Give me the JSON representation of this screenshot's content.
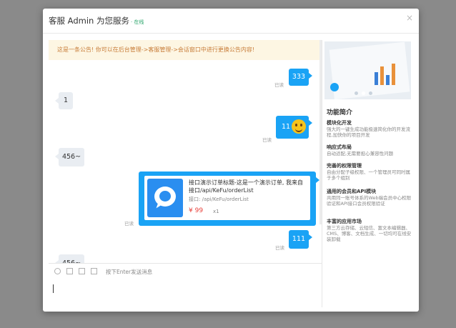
{
  "dialog": {
    "title": "客服 Admin 为您服务",
    "status": "· 在线",
    "close": "×"
  },
  "notice": "这是一条公告! 你可以在后台管理->客服管理->会话窗口中进行更换公告内容!",
  "messages": [
    {
      "from": "me",
      "text": "333",
      "read": "已读"
    },
    {
      "from": "agent",
      "text": "1"
    },
    {
      "from": "me",
      "text": "11",
      "emoji": "smile-emoji-icon",
      "read": "已读"
    },
    {
      "from": "agent",
      "text": "456~"
    },
    {
      "from": "me",
      "type": "order",
      "read": "已读",
      "order": {
        "title": "接口演示订单标题-这是一个演示订单, 我来自接口/api/KeFu/orderList",
        "url": "接口: /api/KeFu/orderList",
        "price": "¥ 99",
        "qty": "x1"
      }
    },
    {
      "from": "me",
      "text": "111",
      "read": "已读"
    },
    {
      "from": "agent",
      "text": "456~"
    }
  ],
  "toolbar": {
    "icons": [
      "smile-icon",
      "folder-icon",
      "image-icon",
      "user-icon"
    ],
    "hint": "按下Enter发送消息"
  },
  "sidebar": {
    "title": "功能简介",
    "features": [
      {
        "name": "模块化开发",
        "desc": "强大的一键生成功能极速简化你的开发流程,加快你的项目开发"
      },
      {
        "name": "响应式布局",
        "desc": "自动适配,无需要担心兼容性问题"
      },
      {
        "name": "完善的权限管理",
        "desc": "自由分配子级权限、一个管理员可同时属于多个组别"
      },
      {
        "name": "通用的会员和API模块",
        "desc": "共用同一账号体系的Web端会员中心权限验证和API接口会员权限验证"
      },
      {
        "name": "丰富的应用市场",
        "desc": "第三方云存储、云短信、富文本编辑器、CMS、博客、文档生成、一切均可在线安装卸载"
      }
    ]
  },
  "colors": {
    "accent": "#1aa3f5",
    "notice_bg": "#fdf6e3",
    "notice_text": "#c87d3a",
    "price": "#e8403a",
    "online": "#29a56a"
  }
}
